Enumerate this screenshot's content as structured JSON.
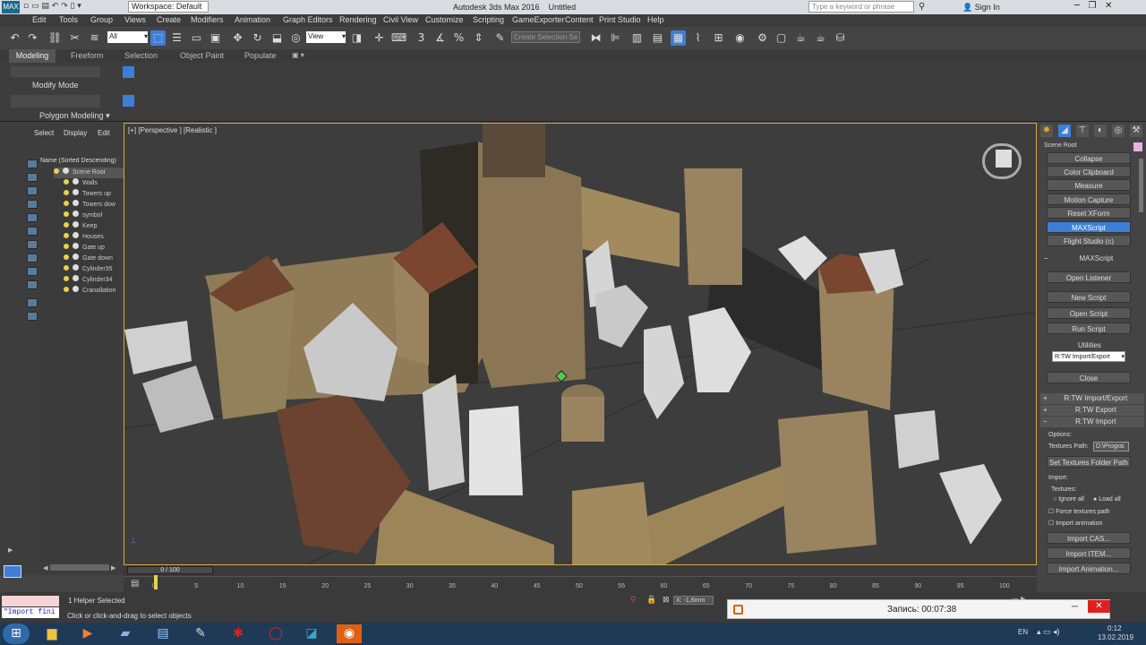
{
  "titlebar": {
    "workspace": "Workspace: Default",
    "title": "Autodesk 3ds Max 2016",
    "file": "Untitled",
    "search_placeholder": "Type a keyword or phrase",
    "sign_in": "Sign In"
  },
  "menu": [
    "Edit",
    "Tools",
    "Group",
    "Views",
    "Create",
    "Modifiers",
    "Animation",
    "Graph Editors",
    "Rendering",
    "Civil View",
    "Customize",
    "Scripting",
    "GameExporter",
    "Content",
    "Print Studio",
    "Help"
  ],
  "toolbar": {
    "filter_value": "All",
    "ref_coord": "View",
    "selection_set_placeholder": "Create Selection Se"
  },
  "ribbon": {
    "tabs": [
      "Modeling",
      "Freeform",
      "Selection",
      "Object Paint",
      "Populate"
    ],
    "modify_mode": "Modify Mode",
    "polygon_modeling": "Polygon Modeling"
  },
  "scene_explorer": {
    "tabs": [
      "Select",
      "Display",
      "Edit"
    ],
    "header": "Name (Sorted Descending)",
    "items": [
      "Scene Root",
      "Walls",
      "Towers up",
      "Towers dow",
      "symbol",
      "Keep",
      "Houses",
      "Gate up",
      "Gate down",
      "Cylinder35",
      "Cylinder34",
      "Cranallation"
    ]
  },
  "viewport": {
    "label": "[+] [Perspective ] [Realistic ]"
  },
  "command_panel": {
    "scene_root": "Scene Root",
    "buttons_top": [
      "Collapse",
      "Color Clipboard",
      "Measure",
      "Motion Capture",
      "Reset XForm",
      "MAXScript",
      "Flight Studio (c)"
    ],
    "maxscript_title": "MAXScript",
    "maxscript_buttons": [
      "Open Listener",
      "New Script",
      "Open Script",
      "Run Script"
    ],
    "utilities_label": "Utilities",
    "utilities_value": "R:TW Import/Export",
    "close": "Close",
    "rollouts": [
      "R:TW Import/Export",
      "R:TW Export",
      "R:TW Import"
    ],
    "options_label": "Options:",
    "textures_path_label": "Textures Path:",
    "textures_path_value": "D:\\Prograi",
    "set_textures_button": "Set Textures Folder Path",
    "import_label": "Import:",
    "textures_label": "Textures:",
    "ignore_all": "Ignore all",
    "load_all": "Load all",
    "force_textures": "Force textures path",
    "import_animation": "Import animation",
    "import_buttons": [
      "Import CAS...",
      "Import ITEM...",
      "Import Animation..."
    ]
  },
  "timeline": {
    "frame": "0 / 100",
    "ticks": [
      "0",
      "5",
      "10",
      "15",
      "20",
      "25",
      "30",
      "35",
      "40",
      "45",
      "50",
      "55",
      "60",
      "65",
      "70",
      "75",
      "80",
      "85",
      "90",
      "95",
      "100"
    ]
  },
  "status": {
    "maxscript_listener": "\"Import fini",
    "selected": "1 Helper Selected",
    "prompt": "Click or click-and-drag to select objects",
    "x_value": "-1,6mm"
  },
  "recording": {
    "label": "Запись: 00:07:38"
  },
  "taskbar": {
    "lang": "EN",
    "time": "0:12",
    "date": "13.02.2019"
  },
  "colors": {
    "accent": "#d5a93c",
    "selection_blue": "#3d7fd6",
    "taskbar": "#1e3a57"
  }
}
